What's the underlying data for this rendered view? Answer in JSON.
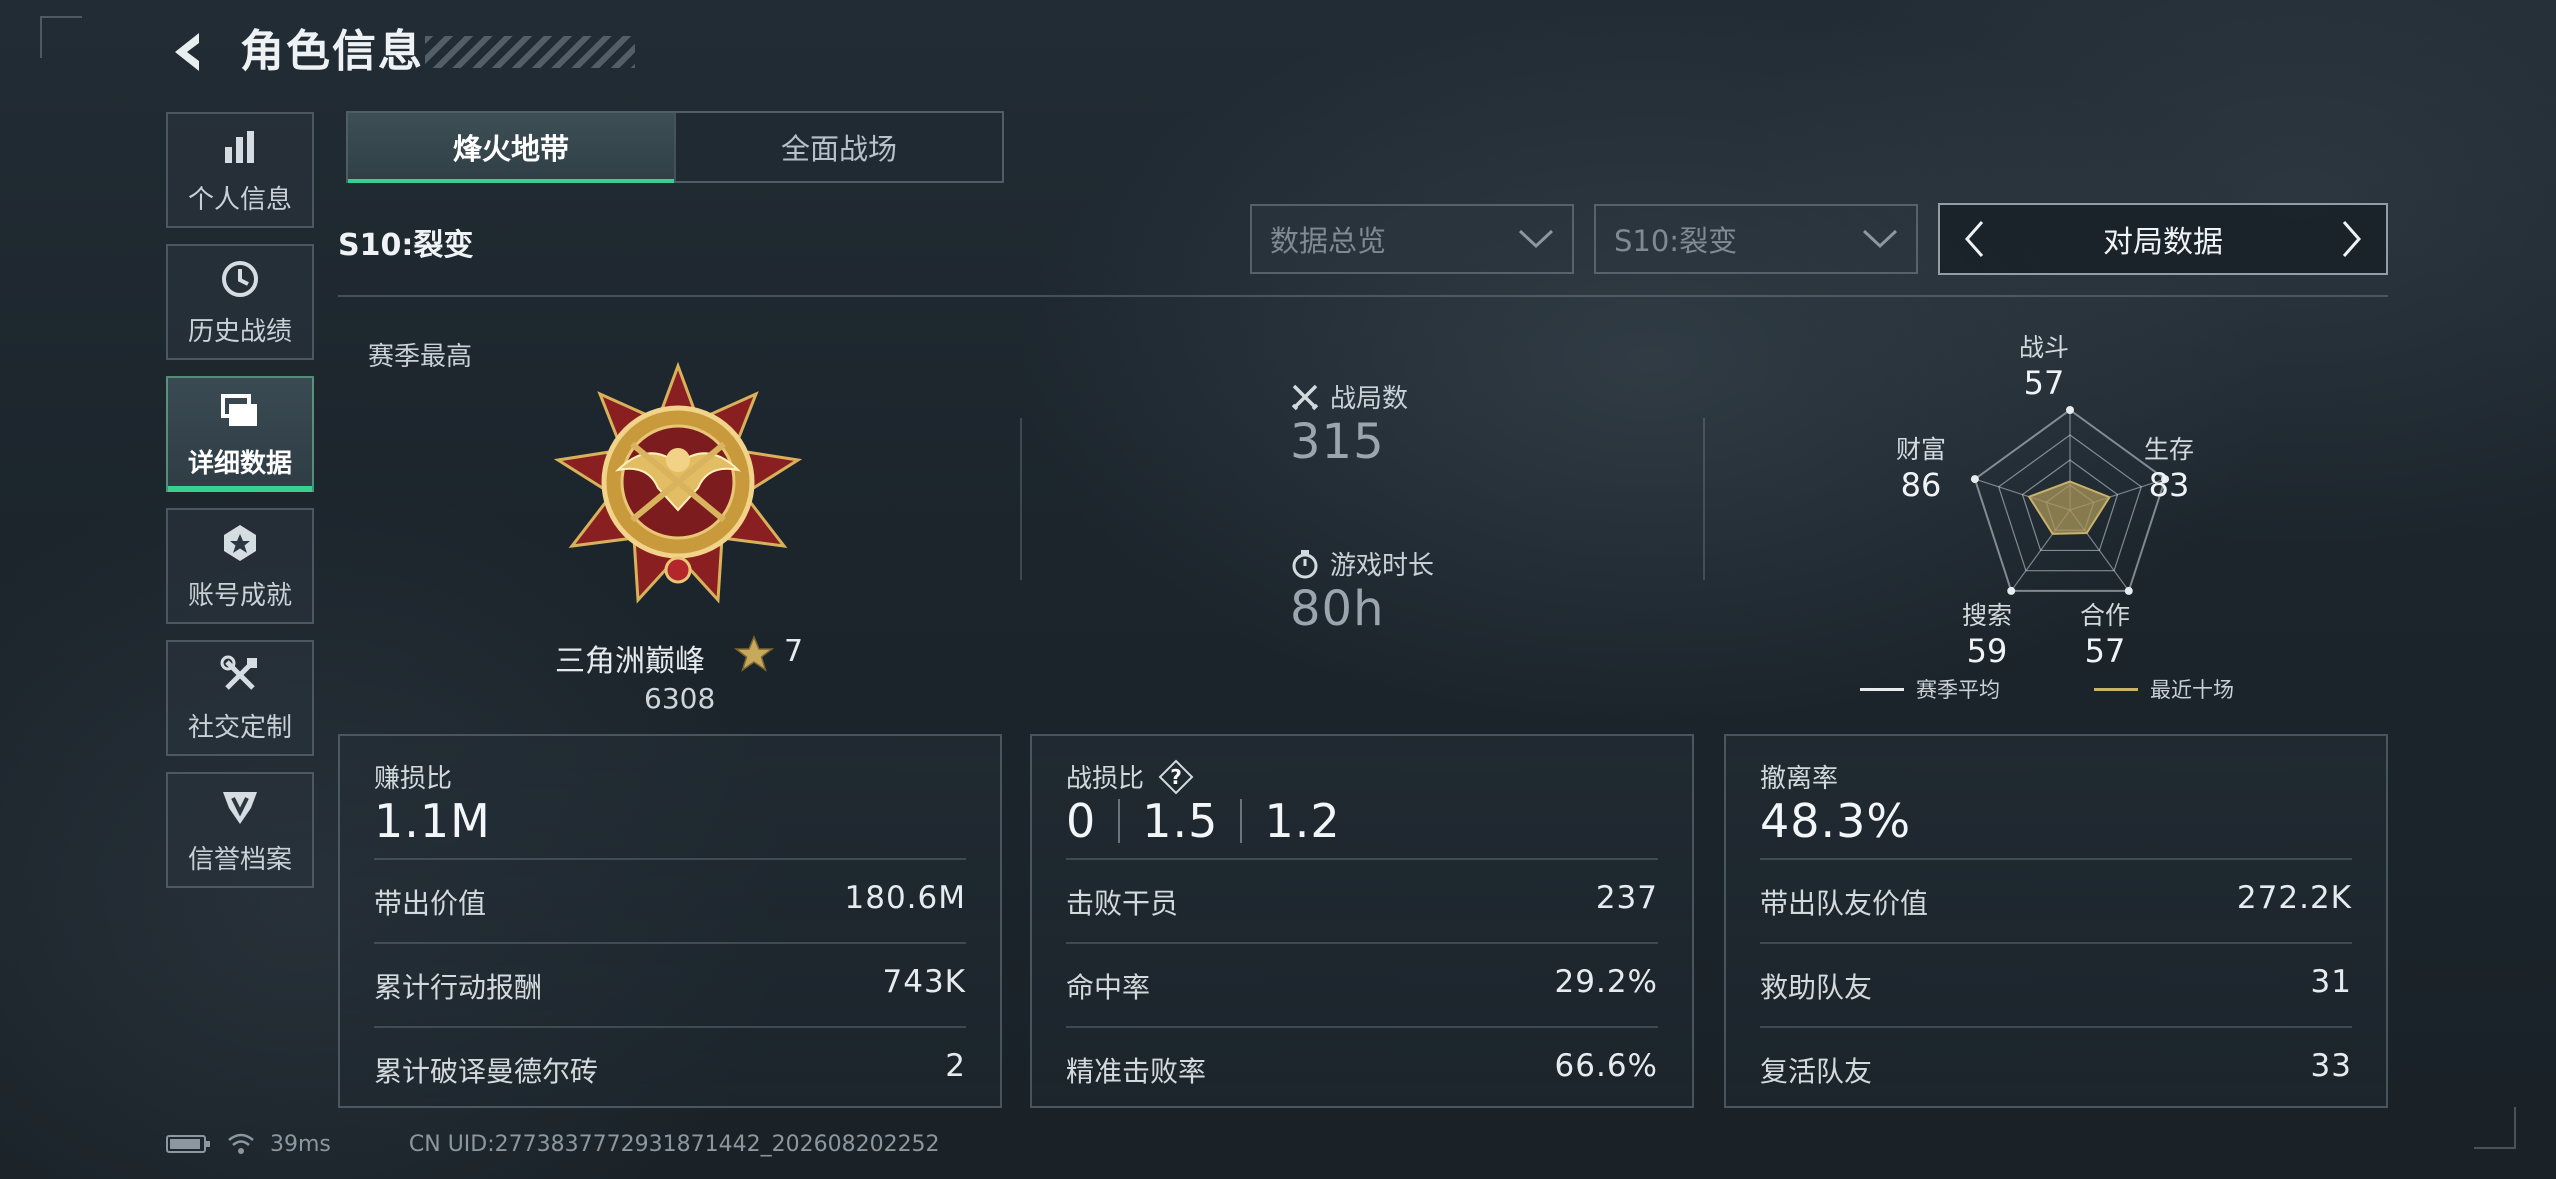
{
  "header": {
    "title": "角色信息"
  },
  "sidebar": {
    "items": [
      {
        "label": "个人信息",
        "icon": "bar-chart-icon"
      },
      {
        "label": "历史战绩",
        "icon": "history-clock-icon"
      },
      {
        "label": "详细数据",
        "icon": "folder-icon",
        "active": true
      },
      {
        "label": "账号成就",
        "icon": "achievement-badge-icon"
      },
      {
        "label": "社交定制",
        "icon": "tools-icon"
      },
      {
        "label": "信誉档案",
        "icon": "reputation-shield-icon"
      }
    ]
  },
  "tabs": [
    {
      "label": "烽火地带",
      "active": true
    },
    {
      "label": "全面战场",
      "active": false
    }
  ],
  "season_label": "S10:裂变",
  "filters": {
    "overview": "数据总览",
    "season": "S10:裂变",
    "match_selector": "对局数据"
  },
  "season_high": {
    "label": "赛季最高",
    "rank_name": "三角洲巅峰",
    "stars": "7",
    "score": "6308"
  },
  "summary": {
    "matches_label": "战局数",
    "matches_value": "315",
    "playtime_label": "游戏时长",
    "playtime_value": "80h"
  },
  "radar": {
    "axes": [
      {
        "label": "战斗",
        "value": "57"
      },
      {
        "label": "生存",
        "value": "83"
      },
      {
        "label": "合作",
        "value": "57"
      },
      {
        "label": "搜索",
        "value": "59"
      },
      {
        "label": "财富",
        "value": "86"
      }
    ],
    "legend": [
      {
        "label": "赛季平均",
        "color": "#e8ecef"
      },
      {
        "label": "最近十场",
        "color": "#c9b26a"
      }
    ]
  },
  "cards": {
    "profit": {
      "title": "赚损比",
      "main": "1.1M",
      "rows": [
        {
          "label": "带出价值",
          "value": "180.6M"
        },
        {
          "label": "累计行动报酬",
          "value": "743K"
        },
        {
          "label": "累计破译曼德尔砖",
          "value": "2"
        }
      ]
    },
    "combat": {
      "title": "战损比",
      "help": "?",
      "ratios": [
        "0",
        "1.5",
        "1.2"
      ],
      "rows": [
        {
          "label": "击败干员",
          "value": "237"
        },
        {
          "label": "命中率",
          "value": "29.2%"
        },
        {
          "label": "精准击败率",
          "value": "66.6%"
        }
      ]
    },
    "extract": {
      "title": "撤离率",
      "main": "48.3%",
      "rows": [
        {
          "label": "带出队友价值",
          "value": "272.2K"
        },
        {
          "label": "救助队友",
          "value": "31"
        },
        {
          "label": "复活队友",
          "value": "33"
        }
      ]
    }
  },
  "footer": {
    "ping": "39ms",
    "uid": "CN UID:2773837772931871442_202608202252"
  }
}
